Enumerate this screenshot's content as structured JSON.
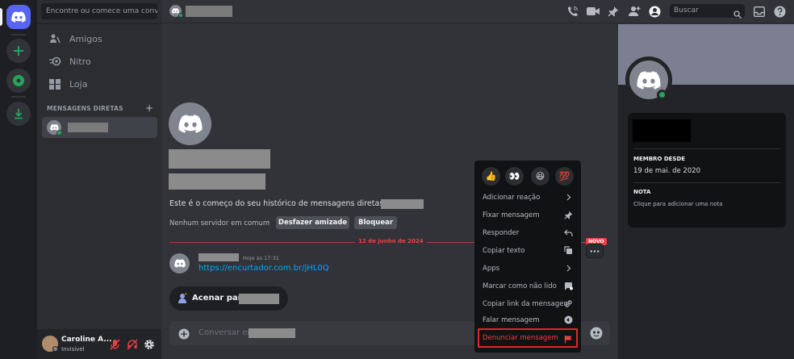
{
  "sidebar": {
    "search_placeholder": "Encontre ou comece uma conver...",
    "nav": [
      {
        "label": "Amigos",
        "icon": "friends-icon"
      },
      {
        "label": "Nitro",
        "icon": "nitro-icon"
      },
      {
        "label": "Loja",
        "icon": "shop-icon"
      }
    ],
    "dm_header": "MENSAGENS DIRETAS",
    "dm_add": "+"
  },
  "user_panel": {
    "name": "Caroline A...",
    "status": "Invisível"
  },
  "header": {
    "search_placeholder": "Buscar"
  },
  "main": {
    "intro": "Este é o começo do seu histórico de mensagens diretas com",
    "mutual": "Nenhum servidor em comum",
    "mutual_sep": "•",
    "remove_friend": "Desfazer amizade",
    "block": "Bloquear",
    "date_divider": "12 de junho de 2024",
    "new_badge": "NOVO",
    "message": {
      "time": "Hoje às 17:31",
      "link": "https://encurtador.com.br/jHL0Q"
    },
    "wave_label": "Acenar para",
    "composer_placeholder": "Conversar em",
    "more_label": "···"
  },
  "context_menu": {
    "reactions": [
      "👍",
      "👀",
      "😆",
      "💯"
    ],
    "items": [
      {
        "label": "Adicionar reação",
        "icon": "chevron-right-icon"
      },
      {
        "label": "Fixar mensagem",
        "icon": "pin-icon"
      },
      {
        "label": "Responder",
        "icon": "reply-icon"
      },
      {
        "label": "Copiar texto",
        "icon": "copy-icon"
      },
      {
        "label": "Apps",
        "icon": "chevron-right-icon"
      },
      {
        "label": "Marcar como não lido",
        "icon": "unread-icon"
      },
      {
        "label": "Copiar link da mensagem",
        "icon": "link-icon"
      },
      {
        "label": "Falar mensagem",
        "icon": "speak-icon"
      },
      {
        "label": "Denunciar mensagem",
        "icon": "flag-icon"
      }
    ]
  },
  "profile": {
    "member_since_label": "MEMBRO DESDE",
    "member_since": "19 de mai. de 2020",
    "note_label": "NOTA",
    "note_placeholder": "Clique para adicionar uma nota"
  },
  "colors": {
    "blurple": "#5865f2",
    "green": "#23a55a",
    "red": "#f23f43",
    "link": "#00a8fc"
  }
}
